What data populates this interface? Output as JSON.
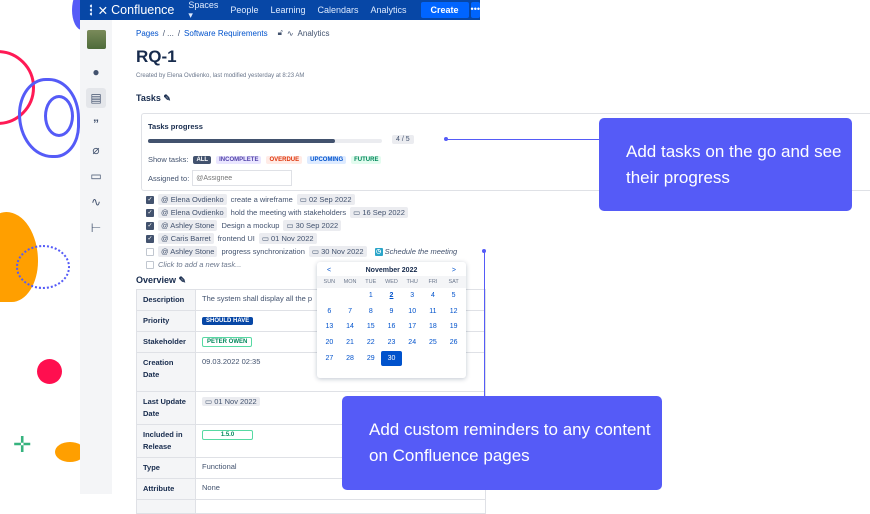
{
  "nav": {
    "brand": "Confluence",
    "items": [
      "Spaces",
      "People",
      "Learning",
      "Calendars",
      "Analytics"
    ],
    "create": "Create",
    "more": "•••"
  },
  "breadcrumb": {
    "pages": "Pages",
    "sep1": "/ ...",
    "sep2": "/",
    "parent": "Software Requirements",
    "analytics": "Analytics"
  },
  "page": {
    "title": "RQ-1",
    "meta": "Created by Elena Ovdienko, last modified yesterday at 8:23 AM",
    "tasks_heading": "Tasks",
    "overview_heading": "Overview"
  },
  "progress": {
    "title": "Tasks progress",
    "done": 4,
    "total": 5,
    "label": "4 / 5",
    "fraction": 0.8
  },
  "filters": {
    "label": "Show tasks:",
    "items": [
      {
        "label": "ALL",
        "bg": "#42526e",
        "fg": "#ffffff"
      },
      {
        "label": "INCOMPLETE",
        "bg": "#eae6ff",
        "fg": "#5243aa"
      },
      {
        "label": "OVERDUE",
        "bg": "#ffebe6",
        "fg": "#de350b"
      },
      {
        "label": "UPCOMING",
        "bg": "#deebff",
        "fg": "#0052cc"
      },
      {
        "label": "FUTURE",
        "bg": "#e3fcef",
        "fg": "#00875a"
      }
    ]
  },
  "assign": {
    "label": "Assigned to:",
    "placeholder": "@Assignee"
  },
  "tasks": [
    {
      "done": true,
      "who": "@ Elena Ovdienko",
      "text": "create a wireframe",
      "date": "02 Sep 2022"
    },
    {
      "done": true,
      "who": "@ Elena Ovdienko",
      "text": "hold the meeting with stakeholders",
      "date": "16 Sep 2022"
    },
    {
      "done": true,
      "who": "@ Ashley Stone",
      "text": "Design a mockup",
      "date": "30 Sep 2022"
    },
    {
      "done": true,
      "who": "@ Caris Barret",
      "text": "frontend UI",
      "date": "01 Nov 2022"
    },
    {
      "done": false,
      "who": "@ Ashley Stone",
      "text": "progress synchronization",
      "date": "30 Nov 2022",
      "reminder": "Schedule the meeting"
    }
  ],
  "new_task": "Click to add a new task...",
  "overview": {
    "description_label": "Description",
    "description": "The system shall display all the p",
    "priority_label": "Priority",
    "priority": "SHOULD HAVE",
    "stakeholder_label": "Stakeholder",
    "stakeholder": "PETER OWEN",
    "creation_label": "Creation Date",
    "creation": "09.03.2022 02:35",
    "update_label": "Last Update Date",
    "update": "01 Nov 2022",
    "release_label": "Included in Release",
    "release": "1.5.0",
    "type_label": "Type",
    "type": "Functional",
    "attribute_label": "Attribute",
    "attribute": "None"
  },
  "calendar": {
    "title": "November 2022",
    "prev": "<",
    "next": ">",
    "dow": [
      "SUN",
      "MON",
      "TUE",
      "WED",
      "THU",
      "FRI",
      "SAT"
    ],
    "first_weekday": 2,
    "days": 30,
    "today": 2,
    "selected": 30
  },
  "callouts": {
    "top": "Add tasks on the go and see their progress",
    "bottom": "Add custom reminders to any content on Confluence pages"
  },
  "colors": {
    "accent": "#555bf7",
    "nav": "#0747a6"
  }
}
